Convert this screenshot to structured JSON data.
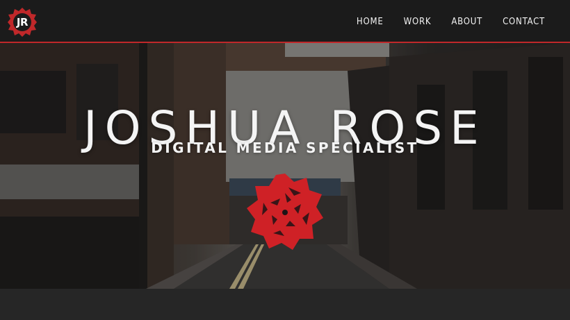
{
  "brand": {
    "logo_text": "JR",
    "accent_color": "#c0282a",
    "logo_icon": "rose-badge-icon"
  },
  "nav": {
    "items": [
      {
        "label": "HOME"
      },
      {
        "label": "WORK"
      },
      {
        "label": "ABOUT"
      },
      {
        "label": "CONTACT"
      }
    ]
  },
  "hero": {
    "title": "JOSHUA ROSE",
    "subtitle": "DIGITAL MEDIA SPECIALIST",
    "emblem_icon": "rose-emblem-icon",
    "background": "street-photo"
  }
}
